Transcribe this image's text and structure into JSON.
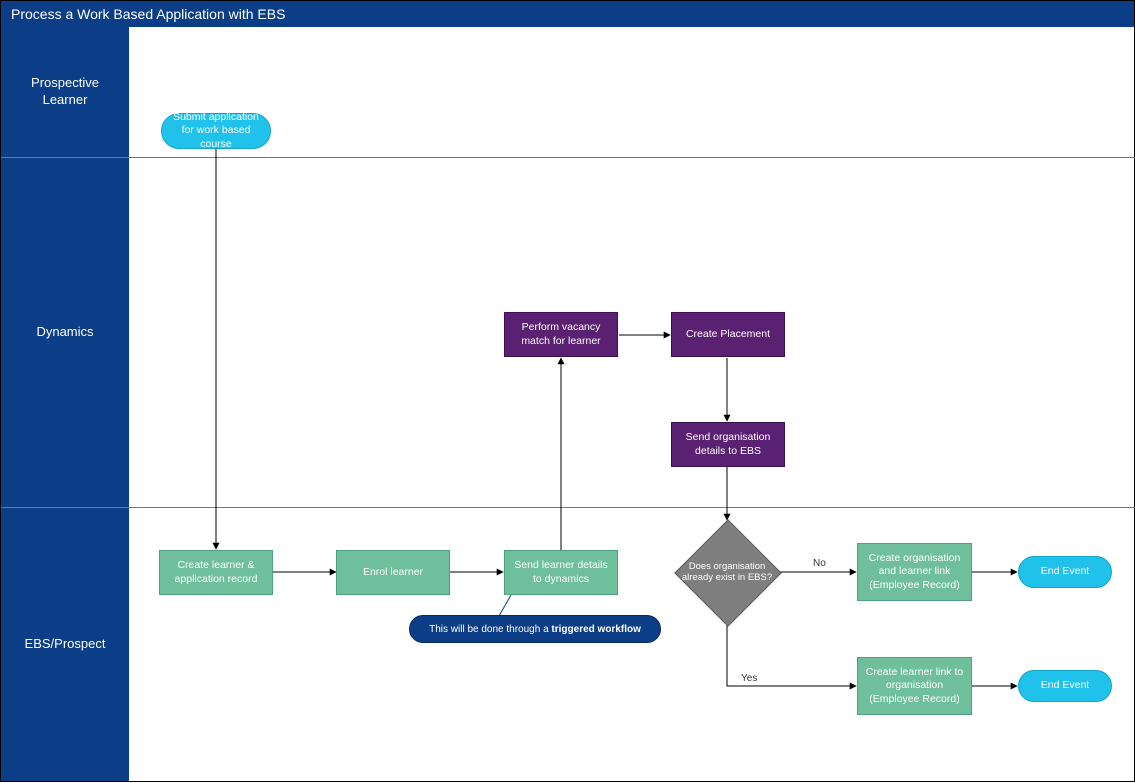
{
  "title": "Process a Work Based Application with EBS",
  "lanes": {
    "lane1": "Prospective Learner",
    "lane2": "Dynamics",
    "lane3": "EBS/Prospect"
  },
  "nodes": {
    "start": "Submit application for work based course",
    "create_record": "Create learner & application record",
    "enrol": "Enrol learner",
    "send_to_dynamics": "Send learner details to dynamics",
    "note_prefix": "This will be done through a ",
    "note_bold": "triggered workflow",
    "vacancy_match": "Perform vacancy match for learner",
    "create_placement": "Create Placement",
    "send_org": "Send organisation details to EBS",
    "decision": "Does organisation already exist in EBS?",
    "no_branch": "Create organisation and learner link (Employee Record)",
    "yes_branch": "Create learner link to organisation (Employee Record)",
    "end1": "End Event",
    "end2": "End Event"
  },
  "edges": {
    "no": "No",
    "yes": "Yes"
  },
  "chart_data": {
    "type": "flowchart",
    "title": "Process a Work Based Application with EBS",
    "swimlanes": [
      "Prospective Learner",
      "Dynamics",
      "EBS/Prospect"
    ],
    "nodes": [
      {
        "id": "start",
        "lane": "Prospective Learner",
        "type": "start",
        "label": "Submit application for work based course"
      },
      {
        "id": "create_record",
        "lane": "EBS/Prospect",
        "type": "process",
        "label": "Create learner & application record"
      },
      {
        "id": "enrol",
        "lane": "EBS/Prospect",
        "type": "process",
        "label": "Enrol learner"
      },
      {
        "id": "send_to_dynamics",
        "lane": "EBS/Prospect",
        "type": "process",
        "label": "Send learner details to dynamics",
        "note": "This will be done through a triggered workflow"
      },
      {
        "id": "vacancy_match",
        "lane": "Dynamics",
        "type": "process",
        "label": "Perform vacancy match for learner"
      },
      {
        "id": "create_placement",
        "lane": "Dynamics",
        "type": "process",
        "label": "Create Placement"
      },
      {
        "id": "send_org",
        "lane": "Dynamics",
        "type": "process",
        "label": "Send organisation details to EBS"
      },
      {
        "id": "decision",
        "lane": "EBS/Prospect",
        "type": "decision",
        "label": "Does organisation already exist in EBS?"
      },
      {
        "id": "no_branch",
        "lane": "EBS/Prospect",
        "type": "process",
        "label": "Create organisation and learner link (Employee Record)"
      },
      {
        "id": "yes_branch",
        "lane": "EBS/Prospect",
        "type": "process",
        "label": "Create learner link to organisation (Employee Record)"
      },
      {
        "id": "end1",
        "lane": "EBS/Prospect",
        "type": "end",
        "label": "End Event"
      },
      {
        "id": "end2",
        "lane": "EBS/Prospect",
        "type": "end",
        "label": "End Event"
      }
    ],
    "edges": [
      {
        "from": "start",
        "to": "create_record"
      },
      {
        "from": "create_record",
        "to": "enrol"
      },
      {
        "from": "enrol",
        "to": "send_to_dynamics"
      },
      {
        "from": "send_to_dynamics",
        "to": "vacancy_match"
      },
      {
        "from": "vacancy_match",
        "to": "create_placement"
      },
      {
        "from": "create_placement",
        "to": "send_org"
      },
      {
        "from": "send_org",
        "to": "decision"
      },
      {
        "from": "decision",
        "to": "no_branch",
        "label": "No"
      },
      {
        "from": "decision",
        "to": "yes_branch",
        "label": "Yes"
      },
      {
        "from": "no_branch",
        "to": "end1"
      },
      {
        "from": "yes_branch",
        "to": "end2"
      }
    ]
  }
}
